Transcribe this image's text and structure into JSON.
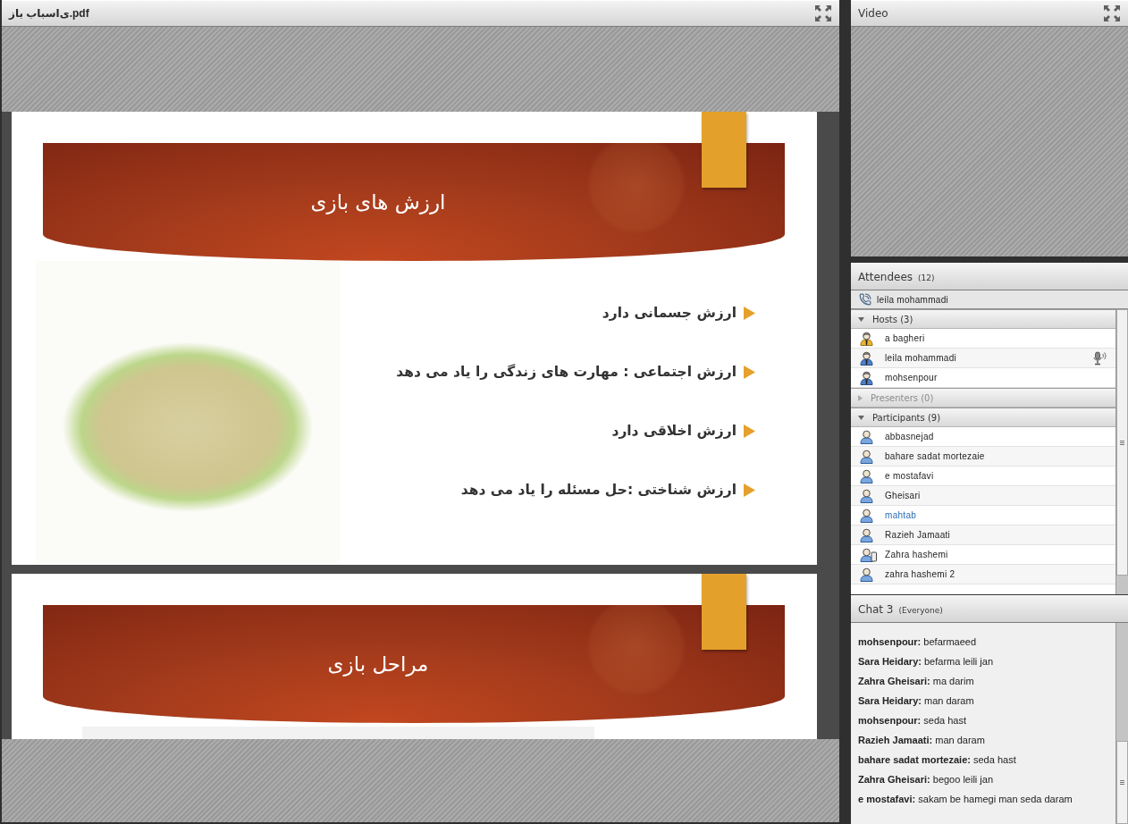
{
  "document_pod": {
    "title": "ی‌اسباب باز.pdf",
    "slides": [
      {
        "title": "ارزش های بازی",
        "bullets": [
          "ارزش جسمانی دارد",
          "ارزش اجتماعی : مهارت های زندگی را یاد می دهد",
          "ارزش اخلاقی دارد",
          "ارزش شناختی :حل مسئله را یاد می دهد"
        ]
      },
      {
        "title": "مراحل بازی"
      }
    ]
  },
  "video_pod": {
    "title": "Video"
  },
  "attendees_pod": {
    "title": "Attendees",
    "count": "(12)",
    "active_speaker": "leila mohammadi",
    "groups": [
      {
        "label": "Hosts (3)",
        "expanded": true,
        "people": [
          {
            "name": "a bagheri",
            "kind": "owner",
            "speaking": false,
            "self": false
          },
          {
            "name": "leila mohammadi",
            "kind": "host",
            "speaking": true,
            "self": false
          },
          {
            "name": "mohsenpour",
            "kind": "host",
            "speaking": false,
            "self": false
          }
        ]
      },
      {
        "label": "Presenters (0)",
        "expanded": false
      },
      {
        "label": "Participants (9)",
        "expanded": true,
        "people": [
          {
            "name": "abbasnejad",
            "kind": "participant",
            "speaking": false,
            "self": false
          },
          {
            "name": "bahare sadat mortezaie",
            "kind": "participant",
            "speaking": false,
            "self": false
          },
          {
            "name": "e mostafavi",
            "kind": "participant",
            "speaking": false,
            "self": false
          },
          {
            "name": "Gheisari",
            "kind": "participant",
            "speaking": false,
            "self": false
          },
          {
            "name": "mahtab",
            "kind": "participant",
            "speaking": false,
            "self": true
          },
          {
            "name": "Razieh Jamaati",
            "kind": "participant",
            "speaking": false,
            "self": false
          },
          {
            "name": "Zahra hashemi",
            "kind": "mobile",
            "speaking": false,
            "self": false
          },
          {
            "name": "zahra hashemi 2",
            "kind": "participant",
            "speaking": false,
            "self": false
          }
        ]
      }
    ]
  },
  "chat_pod": {
    "title": "Chat 3",
    "audience": "(Everyone)",
    "messages": [
      "**mohsenpour:** befarmaeed",
      "**Sara Heidary:** befarma leili jan",
      "**Zahra Gheisari:** ma darim",
      "**Sara Heidary:** man daram",
      "**mohsenpour:** seda hast",
      "**Razieh Jamaati:** man daram",
      "**bahare sadat mortezaie:** seda hast",
      "**Zahra Gheisari:** begoo leili jan",
      "**e mostafavi:** sakam be hamegi man seda daram"
    ]
  }
}
